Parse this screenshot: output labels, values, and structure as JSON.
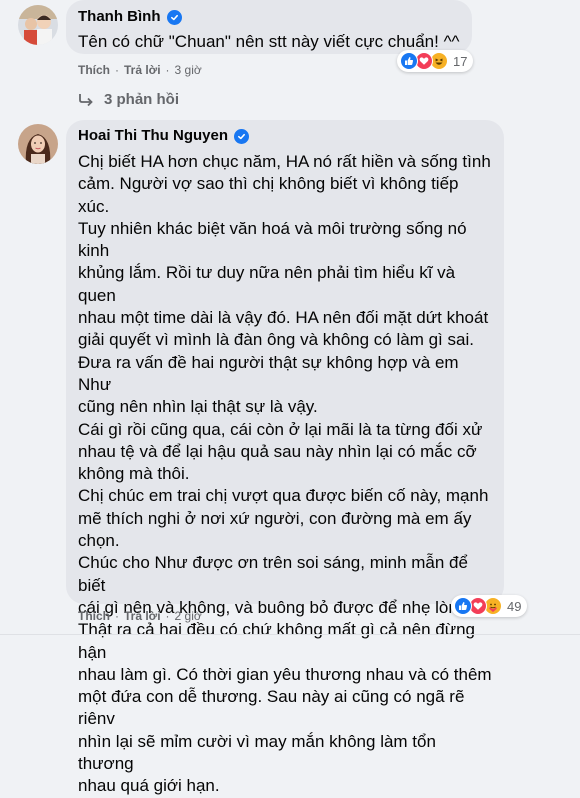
{
  "comment1": {
    "author": "Thanh Bình",
    "text": "Tên có chữ \"Chuan\" nên stt này viết cực chuẩn! ^^",
    "like_label": "Thích",
    "reply_label": "Trả lời",
    "time": "3 giờ",
    "reaction_count": "17"
  },
  "replies_toggle": "3 phản hồi",
  "comment2": {
    "author": "Hoai Thi Thu Nguyen",
    "text": "Chị biết HA hơn chục năm, HA nó rất hiền và sống tình\ncảm. Người vợ sao thì chị không biết vì không tiếp xúc.\nTuy nhiên khác biệt văn hoá và môi trường sống nó kinh\nkhủng lắm. Rồi tư duy nữa nên phải tìm hiểu kĩ và quen\nnhau một time dài là vậy đó. HA nên đối mặt dứt khoát\ngiải quyết vì mình là đàn ông và không có làm gì sai.\nĐưa ra vấn đề hai người thật sự không hợp và em Như\ncũng nên nhìn lại thật sự là vậy.\nCái gì rồi cũng qua, cái còn ở lại mãi là ta từng đối xử\nnhau tệ và để lại hậu quả sau này nhìn lại có mắc cỡ\nkhông mà thôi.\nChị chúc em trai chị vượt qua được biến cố này, mạnh\nmẽ thích nghi ở nơi xứ người, con đường mà em ấy chọn.\nChúc cho Như được ơn trên soi sáng, minh mẫn để biết\ncái gì nên và không, và buông bỏ được để nhẹ lòng.\nThật ra cả hai đều có chứ không mất gì cả nên đừng hận\nnhau làm gì. Có thời gian yêu thương nhau và có thêm\nmột đứa con dễ thương. Sau này ai cũng có ngã rẽ riênv\nnhìn lại sẽ mỉm cười vì may mắn không làm tổn thương\nnhau quá giới hạn.",
    "like_label": "Thích",
    "reply_label": "Trả lời",
    "time": "2 giờ",
    "reaction_count": "49"
  },
  "colors": {
    "like_blue": "#1877f2",
    "love_red": "#f33e58",
    "haha_yellow": "#f7b125",
    "bubble_bg": "#e4e6eb",
    "page_bg": "#f0f2f5"
  },
  "icons": {
    "verified": "verified-check-icon",
    "replies": "reply-arrow-icon",
    "reactions_c1": [
      "like-icon",
      "love-icon",
      "haha-icon"
    ],
    "reactions_c2": [
      "like-icon",
      "love-icon",
      "care-icon"
    ]
  }
}
